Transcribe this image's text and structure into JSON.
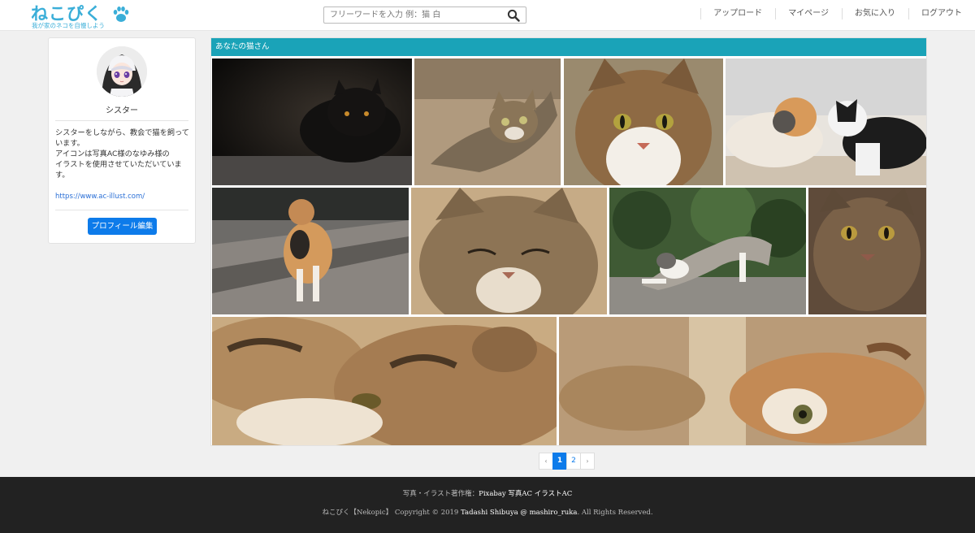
{
  "header": {
    "logo_text": "ねこぴく",
    "logo_tagline": "我が家のネコを自慢しよう",
    "search_placeholder": "フリーワードを入力 例：猫 白",
    "nav": [
      "アップロード",
      "マイページ",
      "お気に入り",
      "ログアウト"
    ]
  },
  "profile": {
    "name": "シスター",
    "bio_lines": [
      "シスターをしながら、教会で猫を飼って",
      "います。",
      "アイコンは写真AC様のなゆみ様の",
      "イラストを使用させていただいていま",
      "す。"
    ],
    "link": "https://www.ac-illust.com/",
    "edit_button": "プロフィール編集"
  },
  "gallery": {
    "title": "あなたの猫さん",
    "photos": [
      {
        "subject": "black-cat"
      },
      {
        "subject": "tabby-lying"
      },
      {
        "subject": "tabby-face-closeup"
      },
      {
        "subject": "two-cats-calico-bw"
      },
      {
        "subject": "calico-walking"
      },
      {
        "subject": "tabby-eyes-closed"
      },
      {
        "subject": "tabby-white-stretching"
      },
      {
        "subject": "tabby-portrait"
      },
      {
        "subject": "tabby-paws-closeup"
      },
      {
        "subject": "kitten-upside-down"
      }
    ]
  },
  "pagination": {
    "prev": "‹",
    "pages": [
      "1",
      "2"
    ],
    "current": "1",
    "next": "›"
  },
  "footer": {
    "credits_prefix": "写真・イラスト著作権：",
    "credits_names": "Pixabay 写真AC イラストAC",
    "copyright_prefix": "ねこぴく【Nekopic】 Copyright © 2019 ",
    "copyright_author": "Tadashi Shibuya @ mashiro_ruka",
    "copyright_suffix": ". All Rights Reserved."
  },
  "colors": {
    "brand": "#3aaed8",
    "accent": "#1aa3b8",
    "primary": "#0d7bea",
    "footer": "#222222"
  }
}
